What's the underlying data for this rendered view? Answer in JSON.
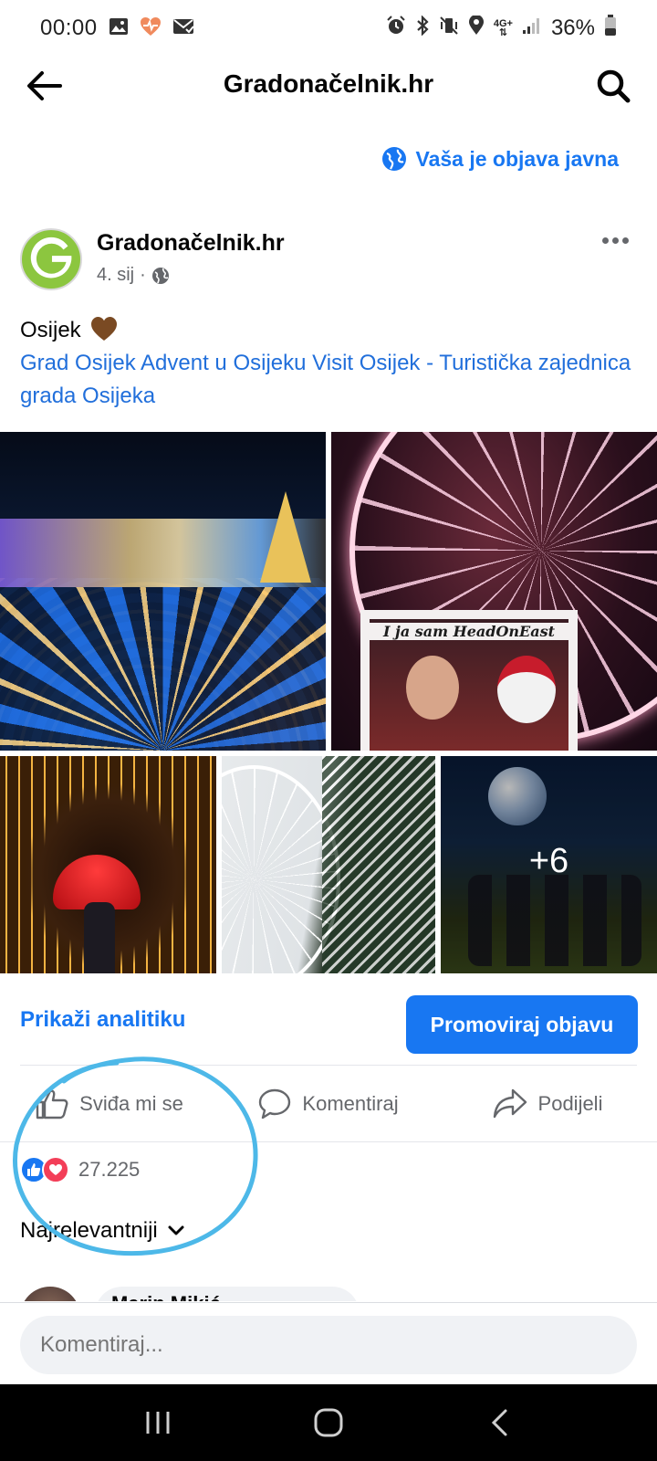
{
  "status_bar": {
    "time": "00:00",
    "battery": "36%",
    "network": "4G+"
  },
  "app_bar": {
    "title": "Gradonačelnik.hr",
    "back_icon": "arrow-left-icon",
    "search_icon": "search-icon"
  },
  "notice": {
    "text": "Vaša je objava javna",
    "icon": "globe-icon"
  },
  "post": {
    "author": "Gradonačelnik.hr",
    "date": "4. sij",
    "audience_icon": "globe-icon",
    "text": "Osijek",
    "links": [
      "Grad Osijek",
      "Advent u Osijeku",
      "Visit Osijek - Turistička zajednica grada Osijeka"
    ],
    "photos_more_count": "+6",
    "photo_frame_text": "I ja sam HeadOnEast"
  },
  "actions": {
    "analytics": "Prikaži analitiku",
    "promote": "Promoviraj objavu",
    "like": "Sviđa mi se",
    "comment": "Komentiraj",
    "share": "Podijeli"
  },
  "reactions": {
    "count": "27.225",
    "types": [
      "like",
      "love"
    ],
    "colors": {
      "like": "#1877f2",
      "love": "#f33e58"
    }
  },
  "comments": {
    "sort_label": "Najrelevantniji",
    "first_commenter": "Marin Mikić",
    "composer_placeholder": "Komentiraj..."
  },
  "colors": {
    "accent": "#1877f2",
    "link": "#216fdb",
    "annotation": "#4db8e8"
  }
}
